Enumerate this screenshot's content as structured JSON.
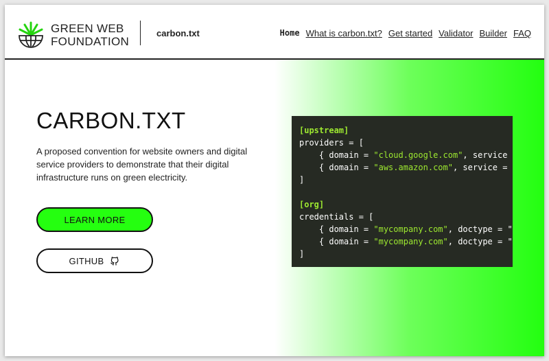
{
  "header": {
    "brand_line1": "GREEN WEB",
    "brand_line2": "FOUNDATION",
    "site_name": "carbon.txt",
    "nav": [
      {
        "label": "Home",
        "active": true
      },
      {
        "label": "What is carbon.txt?"
      },
      {
        "label": "Get started"
      },
      {
        "label": "Validator"
      },
      {
        "label": "Builder"
      },
      {
        "label": "FAQ"
      }
    ]
  },
  "hero": {
    "title": "CARBON.TXT",
    "description": "A proposed convention for website owners and digital service providers to demonstrate that their digital infrastructure runs on green electricity.",
    "learn_more_label": "LEARN MORE",
    "github_label": "GITHUB"
  },
  "code_sample": {
    "lines": [
      {
        "type": "section",
        "text": "[upstream]"
      },
      {
        "type": "plain",
        "text": "providers = ["
      },
      {
        "type": "entry",
        "pre": "    { domain = ",
        "str": "\"cloud.google.com\"",
        "post": ", service = '"
      },
      {
        "type": "entry",
        "pre": "    { domain = ",
        "str": "\"aws.amazon.com\"",
        "post": ", service = '"
      },
      {
        "type": "plain",
        "text": "]"
      },
      {
        "type": "plain",
        "text": ""
      },
      {
        "type": "section",
        "text": "[org]"
      },
      {
        "type": "plain",
        "text": "credentials = ["
      },
      {
        "type": "entry",
        "pre": "    { domain = ",
        "str": "\"mycompany.com\"",
        "post": ", doctype = \"s"
      },
      {
        "type": "entry",
        "pre": "    { domain = ",
        "str": "\"mycompany.com\"",
        "post": ", doctype = \"s"
      },
      {
        "type": "plain",
        "text": "]"
      }
    ]
  },
  "icons": {
    "logo": "green-web-globe-icon",
    "github": "github-icon"
  },
  "colors": {
    "accent_green": "#25ff10",
    "code_bg": "#262a23",
    "code_highlight": "#9de830",
    "text": "#111111"
  }
}
